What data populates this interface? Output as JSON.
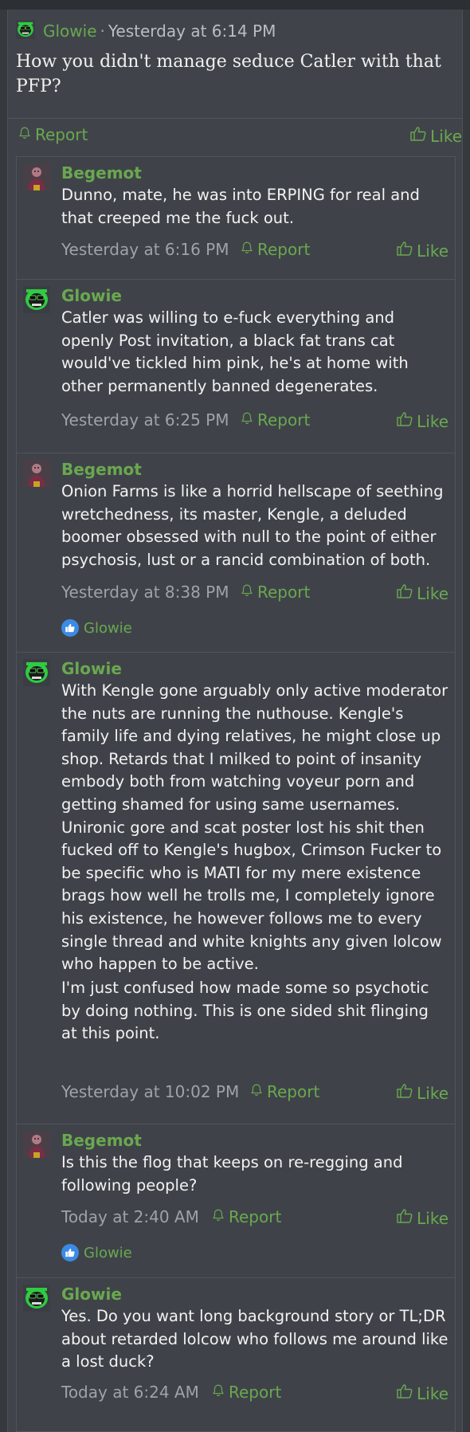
{
  "main_post": {
    "author": "Glowie",
    "separator": "·",
    "timestamp": "Yesterday at 6:14 PM",
    "body": "How you didn't manage seduce Catler with that PFP?",
    "report_label": "Report",
    "like_label": "Like"
  },
  "comments": [
    {
      "author": "Begemot",
      "body": "Dunno, mate, he was into ERPING for real and that creeped me the fuck out.",
      "timestamp": "Yesterday at 6:16 PM",
      "report_label": "Report",
      "like_label": "Like"
    },
    {
      "author": "Glowie",
      "body": "Catler was willing to e-fuck everything and openly Post invitation, a black fat trans cat would've tickled him pink, he's at home with other permanently banned degenerates.",
      "timestamp": "Yesterday at 6:25 PM",
      "report_label": "Report",
      "like_label": "Like"
    },
    {
      "author": "Begemot",
      "body": "Onion Farms is like a horrid hellscape of seething wretchedness, its master, Kengle, a deluded boomer obsessed with null to the point of either psychosis, lust or a rancid combination of both.",
      "timestamp": "Yesterday at 8:38 PM",
      "report_label": "Report",
      "like_label": "Like",
      "reaction_user": "Glowie"
    },
    {
      "author": "Glowie",
      "body": "With Kengle gone arguably only active moderator the nuts are running the nuthouse. Kengle's family life and dying relatives, he might close up shop. Retards that I milked to point of insanity embody both from watching voyeur porn and getting shamed for using same usernames. Unironic gore and scat poster lost his shit then fucked off to Kengle's hugbox, Crimson Fucker to be specific who is MATI for my mere existence brags how well he trolls me, I completely ignore his existence, he however follows me to every single thread and white knights any given lolcow who happen to be active.",
      "body2": "I'm just confused how made some so psychotic by doing nothing. This is one sided shit flinging at this point.",
      "timestamp": "Yesterday at 10:02 PM",
      "report_label": "Report",
      "like_label": "Like"
    },
    {
      "author": "Begemot",
      "body": "Is this the flog that keeps on re-regging and following people?",
      "timestamp": "Today at 2:40 AM",
      "report_label": "Report",
      "like_label": "Like",
      "reaction_user": "Glowie"
    },
    {
      "author": "Glowie",
      "body": "Yes. Do you want long background story or TL;DR about retarded lolcow who follows me around like a lost duck?",
      "timestamp": "Today at 6:24 AM",
      "report_label": "Report",
      "like_label": "Like"
    }
  ],
  "colors": {
    "accent_green": "#6aa84f",
    "background": "#40444a",
    "reaction_blue": "#3b8be6"
  },
  "icons": [
    "glowie-avatar-icon",
    "begemot-avatar-icon",
    "bell-icon",
    "thumbs-up-icon",
    "like-reaction-icon"
  ]
}
